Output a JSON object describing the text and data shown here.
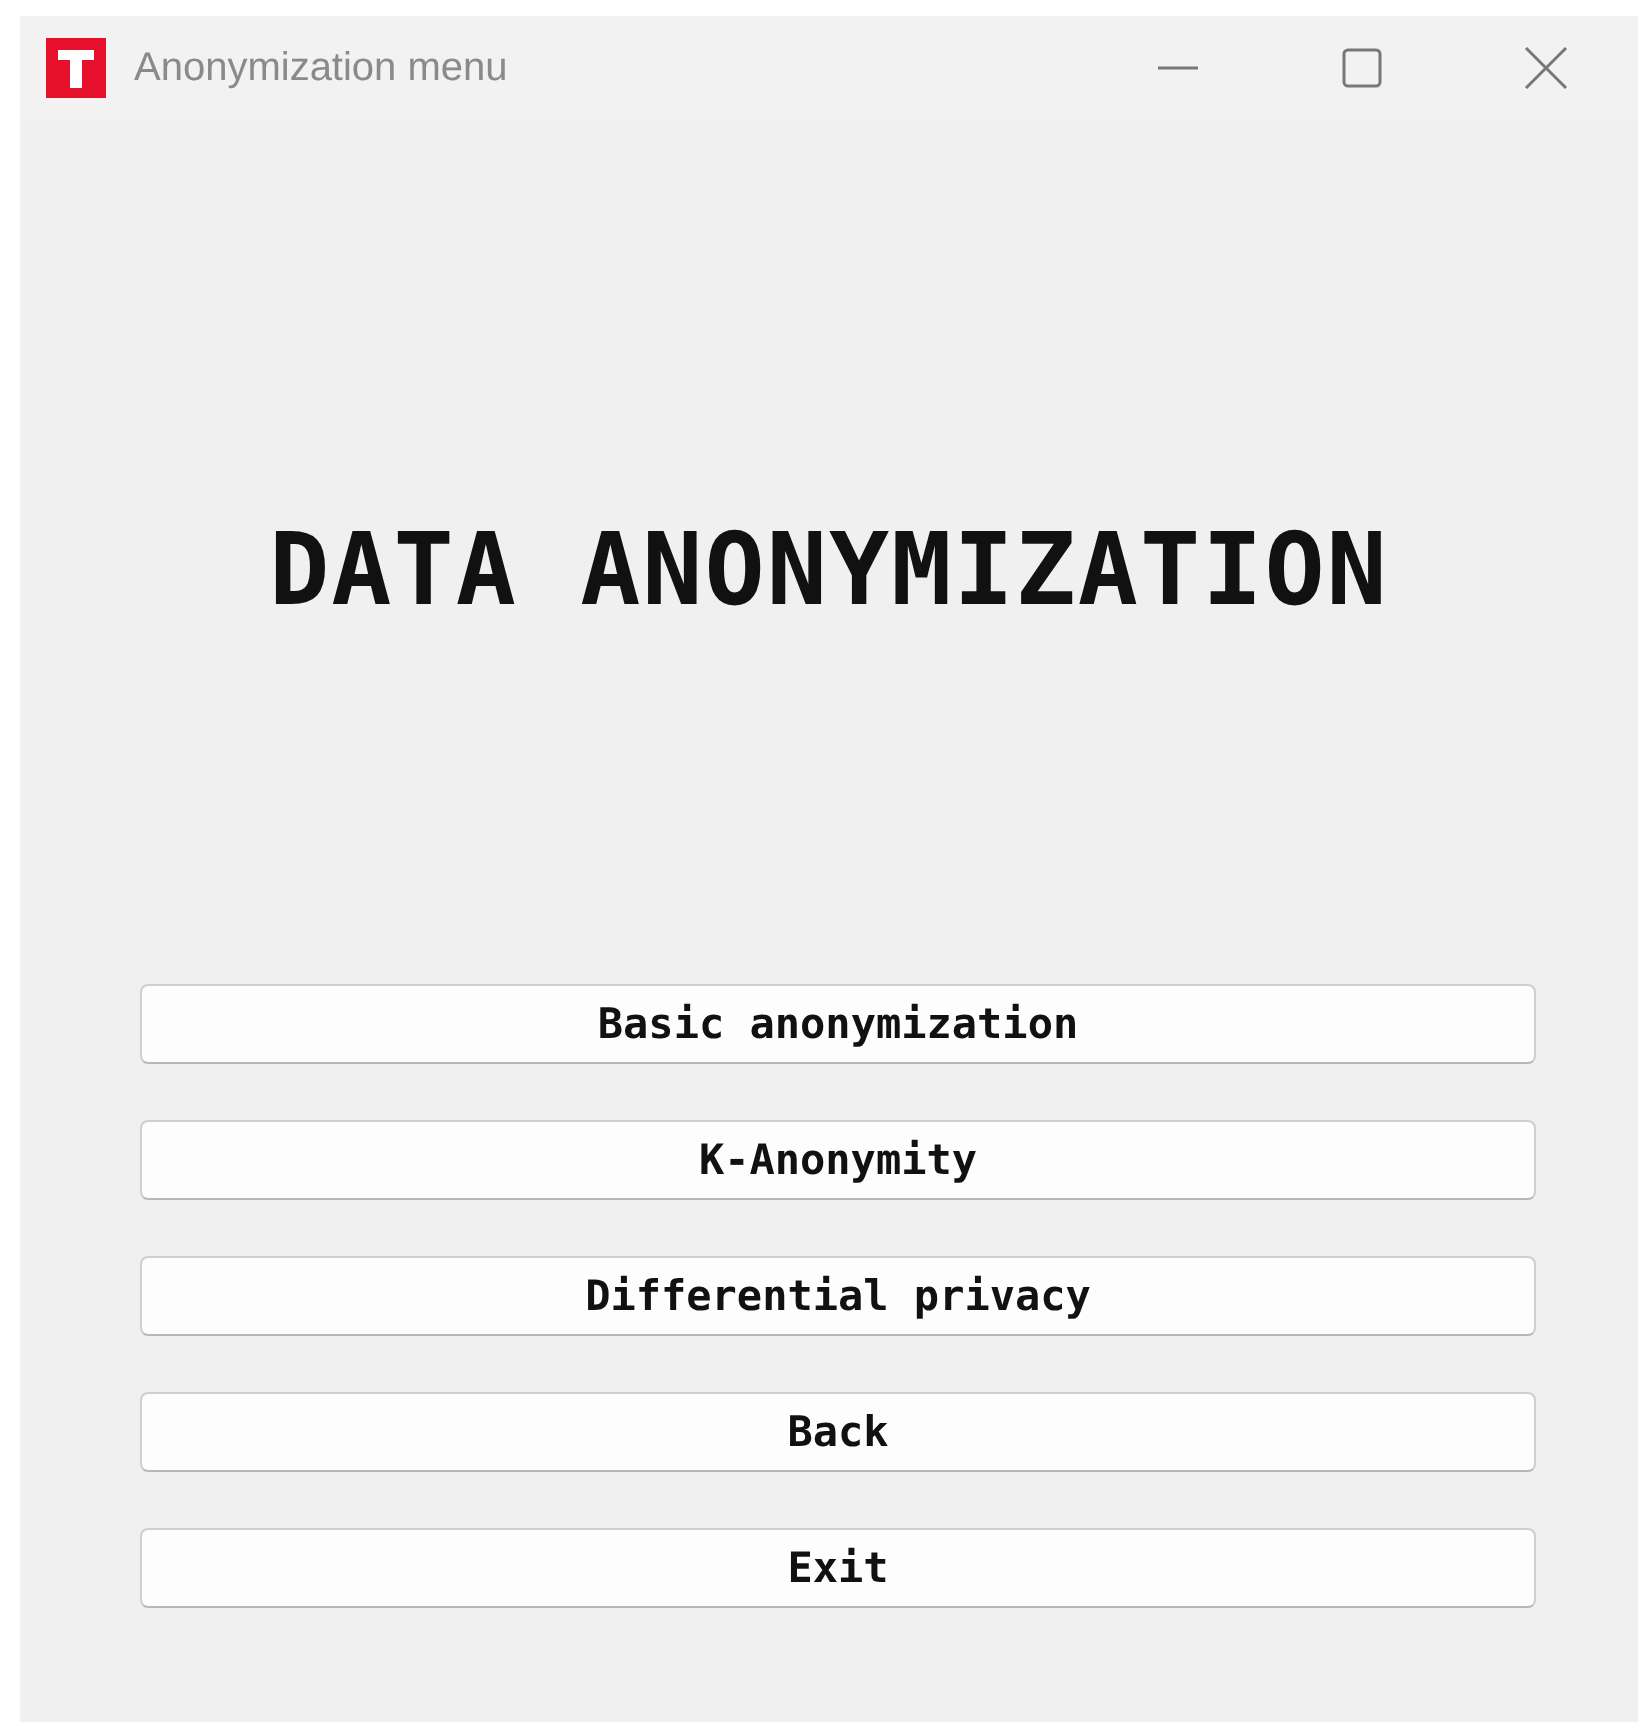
{
  "window": {
    "title": "Anonymization menu"
  },
  "heading": "DATA ANONYMIZATION",
  "buttons": [
    "Basic anonymization",
    "K-Anonymity",
    "Differential privacy",
    "Back",
    "Exit"
  ]
}
